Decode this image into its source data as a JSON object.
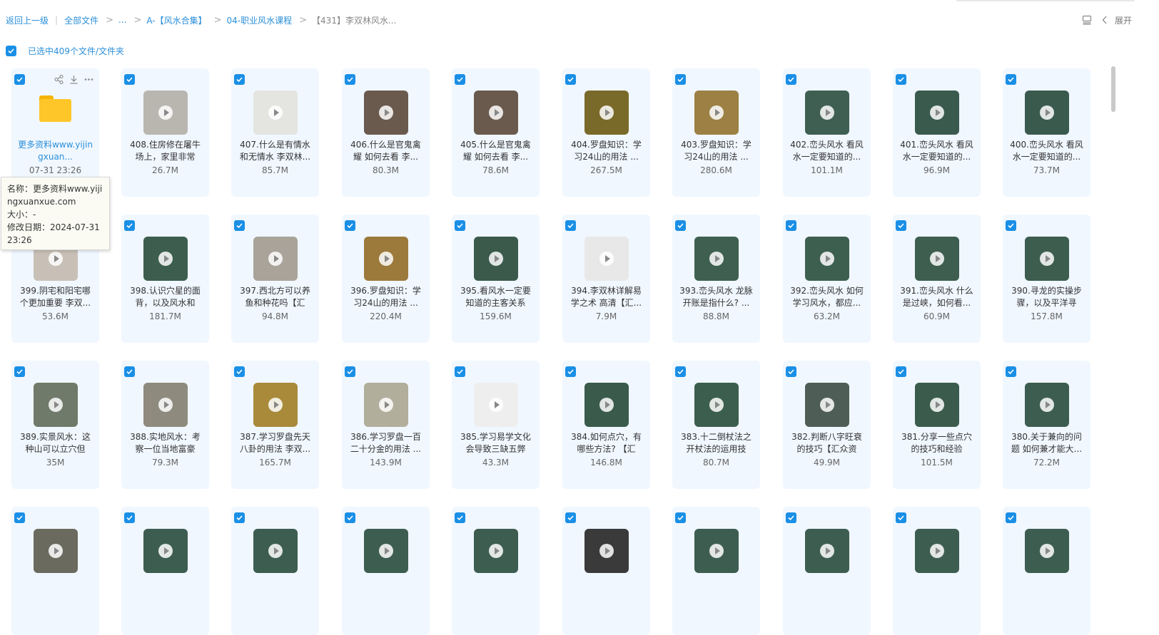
{
  "breadcrumb": {
    "back": "返回上一级",
    "divider": "|",
    "items": [
      "全部文件",
      "...",
      "A-【风水合集】",
      "04-职业风水课程"
    ],
    "current": "【431】李双林风水..."
  },
  "header_right": {
    "expand_label": "展开",
    "view_icon": "list-view-icon",
    "collapse_icon": "chevron-left-icon"
  },
  "selection": {
    "label": "已选中409个文件/文件夹",
    "checked": true
  },
  "accent_color": "#1a8fe6",
  "tooltip": {
    "name_line": "名称：更多资料www.yijingxuanxue.com",
    "size_line": "大小：-",
    "date_line": "修改日期：2024-07-31 23:26"
  },
  "files": [
    {
      "name": "更多资料www.yijingxuan...",
      "size": "07-31 23:26",
      "type": "folder",
      "thumb": "#ffc62a"
    },
    {
      "name": "408.住房修在屠牛场上，家里非常",
      "size": "26.7M",
      "type": "video",
      "thumb": "#b9b6b0"
    },
    {
      "name": "407.什么是有情水和无情水 李双林...",
      "size": "85.7M",
      "type": "video",
      "thumb": "#e4e4e0"
    },
    {
      "name": "406.什么是官鬼禽耀 如何去看 李...",
      "size": "80.3M",
      "type": "video",
      "thumb": "#6a5a4e"
    },
    {
      "name": "405.什么是官鬼禽耀 如何去看 李...",
      "size": "78.6M",
      "type": "video",
      "thumb": "#6a5a4e"
    },
    {
      "name": "404.罗盘知识：学习24山的用法 ...",
      "size": "267.5M",
      "type": "video",
      "thumb": "#7a6a2a"
    },
    {
      "name": "403.罗盘知识：学习24山的用法 ...",
      "size": "280.6M",
      "type": "video",
      "thumb": "#9c8044"
    },
    {
      "name": "402.峦头风水 看风水一定要知道的...",
      "size": "101.1M",
      "type": "video",
      "thumb": "#3f5f52"
    },
    {
      "name": "401.峦头风水 看风水一定要知道的...",
      "size": "96.9M",
      "type": "video",
      "thumb": "#3a5a4e"
    },
    {
      "name": "400.峦头风水 看风水一定要知道的...",
      "size": "73.7M",
      "type": "video",
      "thumb": "#3a5a4e"
    },
    {
      "name": "399.阴宅和阳宅哪个更加重要 李双...",
      "size": "53.6M",
      "type": "video",
      "thumb": "#c8c0b6"
    },
    {
      "name": "398.认识穴星的面背，以及风水和",
      "size": "181.7M",
      "type": "video",
      "thumb": "#3d5e4f"
    },
    {
      "name": "397.西北方可以养鱼和种花吗【汇",
      "size": "94.8M",
      "type": "video",
      "thumb": "#a9a39a"
    },
    {
      "name": "396.罗盘知识：学习24山的用法 ...",
      "size": "220.4M",
      "type": "video",
      "thumb": "#9c7a3c"
    },
    {
      "name": "395.看风水一定要知道的主客关系",
      "size": "159.6M",
      "type": "video",
      "thumb": "#3b5a4c"
    },
    {
      "name": "394.李双林详解易学之术 高清【汇...",
      "size": "7.9M",
      "type": "video",
      "thumb": "#e8e8e8"
    },
    {
      "name": "393.峦头风水 龙脉开账是指什么? ...",
      "size": "88.8M",
      "type": "video",
      "thumb": "#3f6050"
    },
    {
      "name": "392.峦头风水 如何学习风水，都应...",
      "size": "63.2M",
      "type": "video",
      "thumb": "#3d5f50"
    },
    {
      "name": "391.峦头风水 什么是过峡，如何看...",
      "size": "60.9M",
      "type": "video",
      "thumb": "#3e5e50"
    },
    {
      "name": "390.寻龙的实操步骤，以及平洋寻",
      "size": "157.8M",
      "type": "video",
      "thumb": "#3d5d4f"
    },
    {
      "name": "389.实景风水：这种山可以立穴但",
      "size": "35M",
      "type": "video",
      "thumb": "#6f7a6a"
    },
    {
      "name": "388.实地风水：考察一位当地富豪",
      "size": "79.3M",
      "type": "video",
      "thumb": "#8e8a7e"
    },
    {
      "name": "387.学习罗盘先天八卦的用法 李双...",
      "size": "165.7M",
      "type": "video",
      "thumb": "#a88a3a"
    },
    {
      "name": "386.学习罗盘一百二十分金的用法 ...",
      "size": "143.9M",
      "type": "video",
      "thumb": "#b2ae9c"
    },
    {
      "name": "385.学习易学文化会导致三缺五弊",
      "size": "43.3M",
      "type": "video",
      "thumb": "#eeeeee"
    },
    {
      "name": "384.如何点穴，有哪些方法? 【汇",
      "size": "146.8M",
      "type": "video",
      "thumb": "#3a5a4c"
    },
    {
      "name": "383.十二倒杖法之开杖法的运用技",
      "size": "80.7M",
      "type": "video",
      "thumb": "#3c5e4e"
    },
    {
      "name": "382.判断八字旺衰的技巧【汇众资",
      "size": "49.9M",
      "type": "video",
      "thumb": "#4e5e56"
    },
    {
      "name": "381.分享一些点穴的技巧和经验",
      "size": "101.5M",
      "type": "video",
      "thumb": "#3b5c4d"
    },
    {
      "name": "380.关于兼向的问题 如何兼才能大...",
      "size": "72.2M",
      "type": "video",
      "thumb": "#3d5d50"
    },
    {
      "name": "",
      "size": "",
      "type": "video",
      "thumb": "#6b6a5e"
    },
    {
      "name": "",
      "size": "",
      "type": "video",
      "thumb": "#3d5d50"
    },
    {
      "name": "",
      "size": "",
      "type": "video",
      "thumb": "#3d5d50"
    },
    {
      "name": "",
      "size": "",
      "type": "video",
      "thumb": "#3d5d50"
    },
    {
      "name": "",
      "size": "",
      "type": "video",
      "thumb": "#3d5d50"
    },
    {
      "name": "",
      "size": "",
      "type": "video",
      "thumb": "#3a3a3a"
    },
    {
      "name": "",
      "size": "",
      "type": "video",
      "thumb": "#3d5d50"
    },
    {
      "name": "",
      "size": "",
      "type": "video",
      "thumb": "#3d5d50"
    },
    {
      "name": "",
      "size": "",
      "type": "video",
      "thumb": "#3d5d50"
    },
    {
      "name": "",
      "size": "",
      "type": "video",
      "thumb": "#3d5d50"
    }
  ]
}
